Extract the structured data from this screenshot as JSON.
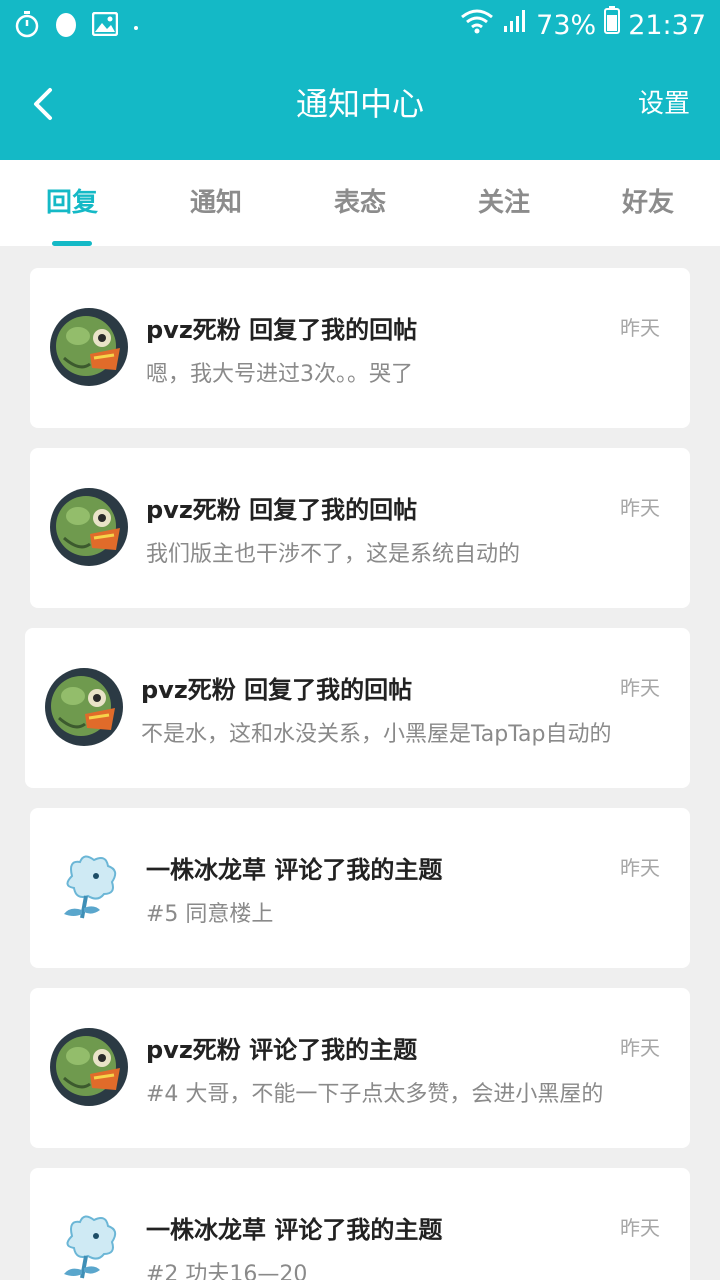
{
  "statusbar": {
    "battery": "73%",
    "time": "21:37"
  },
  "header": {
    "title": "通知中心",
    "settings_label": "设置"
  },
  "tabs": [
    {
      "label": "回复",
      "active": true
    },
    {
      "label": "通知"
    },
    {
      "label": "表态"
    },
    {
      "label": "关注"
    },
    {
      "label": "好友"
    }
  ],
  "notifications": [
    {
      "user": "pvz死粉",
      "action": "回复了我的回帖",
      "preview": "嗯，我大号进过3次。。哭了",
      "time": "昨天",
      "avatar": "zombie"
    },
    {
      "user": "pvz死粉",
      "action": "回复了我的回帖",
      "preview": "我们版主也干涉不了，这是系统自动的",
      "time": "昨天",
      "avatar": "zombie"
    },
    {
      "user": "pvz死粉",
      "action": "回复了我的回帖",
      "preview": "不是水，这和水没关系，小黑屋是TapTap自动的",
      "time": "昨天",
      "avatar": "zombie"
    },
    {
      "user": "一株冰龙草",
      "action": "评论了我的主题",
      "preview": "#5 同意楼上",
      "time": "昨天",
      "avatar": "iceplant"
    },
    {
      "user": "pvz死粉",
      "action": "评论了我的主题",
      "preview": "#4 大哥，不能一下子点太多赞，会进小黑屋的",
      "time": "昨天",
      "avatar": "zombie"
    },
    {
      "user": "一株冰龙草",
      "action": "评论了我的主题",
      "preview": "#2 功夫16—20",
      "time": "昨天",
      "avatar": "iceplant"
    }
  ]
}
